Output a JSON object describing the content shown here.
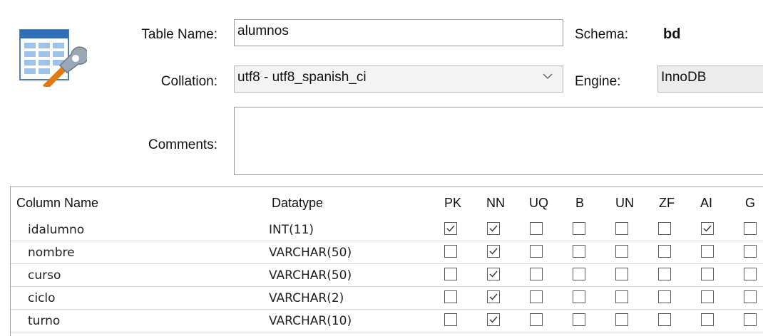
{
  "form": {
    "table_name_label": "Table Name:",
    "table_name_value": "alumnos",
    "schema_label": "Schema:",
    "schema_value": "bd",
    "collation_label": "Collation:",
    "collation_value": "utf8 - utf8_spanish_ci",
    "engine_label": "Engine:",
    "engine_value": "InnoDB",
    "comments_label": "Comments:",
    "comments_value": ""
  },
  "grid": {
    "headers": [
      "Column Name",
      "Datatype",
      "PK",
      "NN",
      "UQ",
      "B",
      "UN",
      "ZF",
      "AI",
      "G"
    ],
    "rows": [
      {
        "name": "idalumno",
        "type": "INT(11)",
        "flags": [
          true,
          true,
          false,
          false,
          false,
          false,
          true,
          false
        ]
      },
      {
        "name": "nombre",
        "type": "VARCHAR(50)",
        "flags": [
          false,
          true,
          false,
          false,
          false,
          false,
          false,
          false
        ]
      },
      {
        "name": "curso",
        "type": "VARCHAR(50)",
        "flags": [
          false,
          true,
          false,
          false,
          false,
          false,
          false,
          false
        ]
      },
      {
        "name": "ciclo",
        "type": "VARCHAR(2)",
        "flags": [
          false,
          true,
          false,
          false,
          false,
          false,
          false,
          false
        ]
      },
      {
        "name": "turno",
        "type": "VARCHAR(10)",
        "flags": [
          false,
          true,
          false,
          false,
          false,
          false,
          false,
          false
        ]
      }
    ]
  },
  "icons": {
    "app": "table-edit-icon",
    "dropdown": "chevron-down-icon",
    "checkbox": "checkmark-icon"
  }
}
